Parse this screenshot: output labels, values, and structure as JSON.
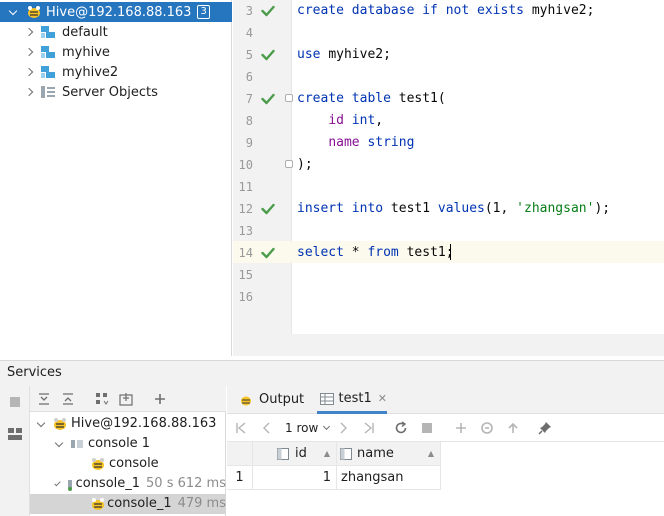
{
  "db_tree": {
    "connection": {
      "label": "Hive@192.168.88.163",
      "badge": "3"
    },
    "items": [
      {
        "label": "default"
      },
      {
        "label": "myhive"
      },
      {
        "label": "myhive2"
      },
      {
        "label": "Server Objects"
      }
    ]
  },
  "editor": {
    "lines": [
      {
        "num": "3",
        "check": true,
        "tokens": [
          [
            "kw",
            "create database if not exists "
          ],
          [
            "plain",
            "myhive2;"
          ]
        ]
      },
      {
        "num": "4",
        "check": false,
        "tokens": []
      },
      {
        "num": "5",
        "check": true,
        "tokens": [
          [
            "kw",
            "use "
          ],
          [
            "plain",
            "myhive2;"
          ]
        ]
      },
      {
        "num": "6",
        "check": false,
        "tokens": []
      },
      {
        "num": "7",
        "check": true,
        "tokens": [
          [
            "kw",
            "create table "
          ],
          [
            "plain",
            "test1("
          ]
        ]
      },
      {
        "num": "8",
        "check": false,
        "tokens": [
          [
            "plain",
            "    "
          ],
          [
            "fld",
            "id "
          ],
          [
            "kw",
            "int"
          ],
          [
            "plain",
            ","
          ]
        ]
      },
      {
        "num": "9",
        "check": false,
        "tokens": [
          [
            "plain",
            "    "
          ],
          [
            "fld",
            "name "
          ],
          [
            "kw",
            "string"
          ]
        ]
      },
      {
        "num": "10",
        "check": false,
        "tokens": [
          [
            "plain",
            ");"
          ]
        ]
      },
      {
        "num": "11",
        "check": false,
        "tokens": []
      },
      {
        "num": "12",
        "check": true,
        "tokens": [
          [
            "kw",
            "insert into "
          ],
          [
            "plain",
            "test1 "
          ],
          [
            "kw",
            "values"
          ],
          [
            "plain",
            "(1, "
          ],
          [
            "str",
            "'zhangsan'"
          ],
          [
            "plain",
            ");"
          ]
        ]
      },
      {
        "num": "13",
        "check": false,
        "tokens": []
      },
      {
        "num": "14",
        "check": true,
        "tokens": [
          [
            "kw",
            "select "
          ],
          [
            "plain",
            "* "
          ],
          [
            "kw",
            "from "
          ],
          [
            "plain",
            "test1;"
          ]
        ]
      },
      {
        "num": "15",
        "check": false,
        "tokens": []
      },
      {
        "num": "16",
        "check": false,
        "tokens": []
      }
    ]
  },
  "services": {
    "title": "Services",
    "tree": {
      "connection": "Hive@192.168.88.163",
      "console1": "console 1",
      "console": "console",
      "console_1_group": "console_1",
      "console_1_group_time": "50 s 612 ms",
      "console_1": "console_1",
      "console_1_time": "479 ms"
    }
  },
  "results": {
    "tabs": [
      {
        "label": "Output"
      },
      {
        "label": "test1"
      }
    ],
    "rows_selector": "1 row",
    "columns": [
      "id",
      "name"
    ],
    "rows": [
      {
        "row_num": "1",
        "id": "1",
        "name": "zhangsan"
      }
    ]
  },
  "colors": {
    "selection_blue": "#2675bf",
    "check_green": "#4a9c4a",
    "keyword": "#0033b3",
    "field": "#871094",
    "string": "#067d17"
  }
}
